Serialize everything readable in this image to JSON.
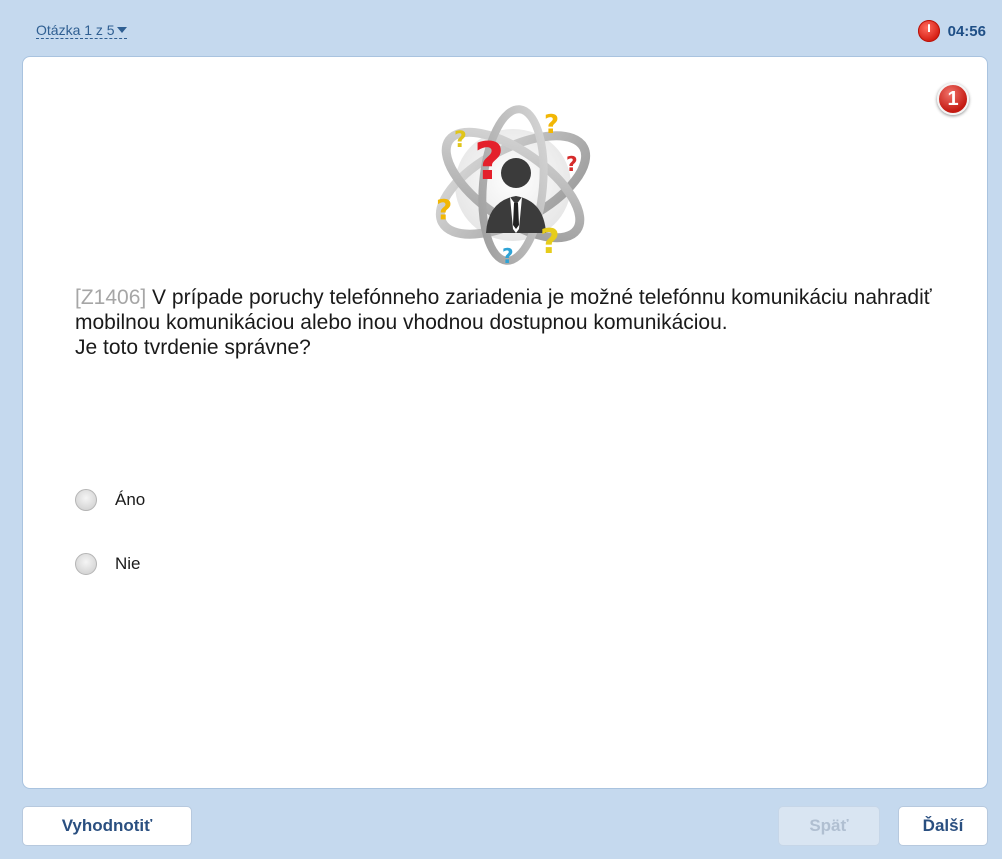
{
  "header": {
    "question_nav_label": "Otázka 1 z 5",
    "timer": "04:56"
  },
  "question": {
    "number_badge": "1",
    "code": "[Z1406]",
    "text_line1": " V prípade poruchy telefónneho zariadenia je možné telefónnu komunikáciu nahradiť mobilnou komunikáciou alebo inou vhodnou dostupnou komunikáciou.",
    "text_line2": "Je toto tvrdenie správne?"
  },
  "answers": [
    {
      "label": "Áno",
      "selected": false
    },
    {
      "label": "Nie",
      "selected": false
    }
  ],
  "footer": {
    "evaluate_label": "Vyhodnotiť",
    "back_label": "Späť",
    "next_label": "Ďalší"
  },
  "colors": {
    "background": "#c5d9ee",
    "accent_text": "#2a4f80",
    "timer_red": "#d51d12",
    "disabled_button": "#d9e5f2"
  },
  "icons": [
    "chevron-down-icon",
    "clock-icon",
    "question-number-badge",
    "question-person-illustration"
  ]
}
